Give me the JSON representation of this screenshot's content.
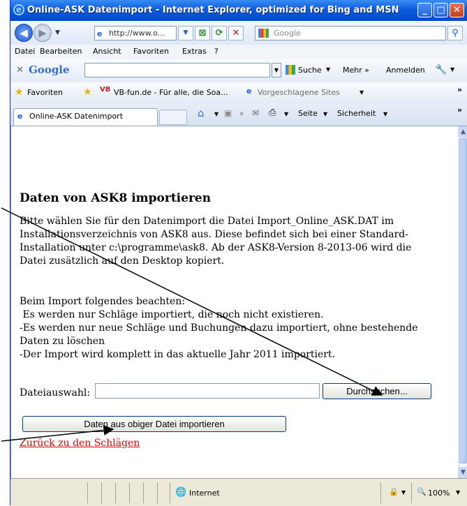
{
  "window": {
    "title": "Online-ASK Datenimport - Internet Explorer, optimized for Bing and MSN"
  },
  "nav": {
    "address": "http://www.o...",
    "search_placeholder": "Google"
  },
  "menu": [
    "Datei",
    "Bearbeiten",
    "Ansicht",
    "Favoriten",
    "Extras",
    "?"
  ],
  "google_toolbar": {
    "brand": "Google",
    "search_label": "Suche",
    "more_label": "Mehr »",
    "signin_label": "Anmelden"
  },
  "favorites": {
    "label": "Favoriten",
    "items": [
      "VB-fun.de - Für alle, die Soa...",
      "Vorgeschlagene Sites"
    ]
  },
  "tab": {
    "label": "Online-ASK Datenimport"
  },
  "command_bar": {
    "page_label": "Seite",
    "safety_label": "Sicherheit"
  },
  "page": {
    "heading": "Daten von ASK8 importieren",
    "intro_lines": [
      "Bitte wählen Sie für den Datenimport die Datei Import_Online_ASK.DAT im",
      "Installationsverzeichnis von ASK8 aus. Diese befindet sich bei einer Standard-",
      "Installation unter c:\\programme\\ask8. Ab der ASK8-Version 8-2013-06 wird die",
      "Datei zusätzlich auf den Desktop kopiert."
    ],
    "notes_lines": [
      "Beim Import folgendes beachten:",
      " Es werden nur Schläge importiert, die noch nicht existieren.",
      "-Es werden nur neue Schläge und Buchungen dazu importiert, ohne bestehende",
      "Daten zu löschen",
      "-Der Import wird komplett in das aktuelle Jahr 2011 importiert."
    ],
    "file_label": "Dateiauswahl:",
    "file_value": "",
    "browse_button": "Durchsuchen...",
    "import_button": "Daten aus obiger Datei importieren",
    "back_link": "Zurück zu den Schlägen"
  },
  "status": {
    "zone": "Internet",
    "zoom": "100%"
  }
}
